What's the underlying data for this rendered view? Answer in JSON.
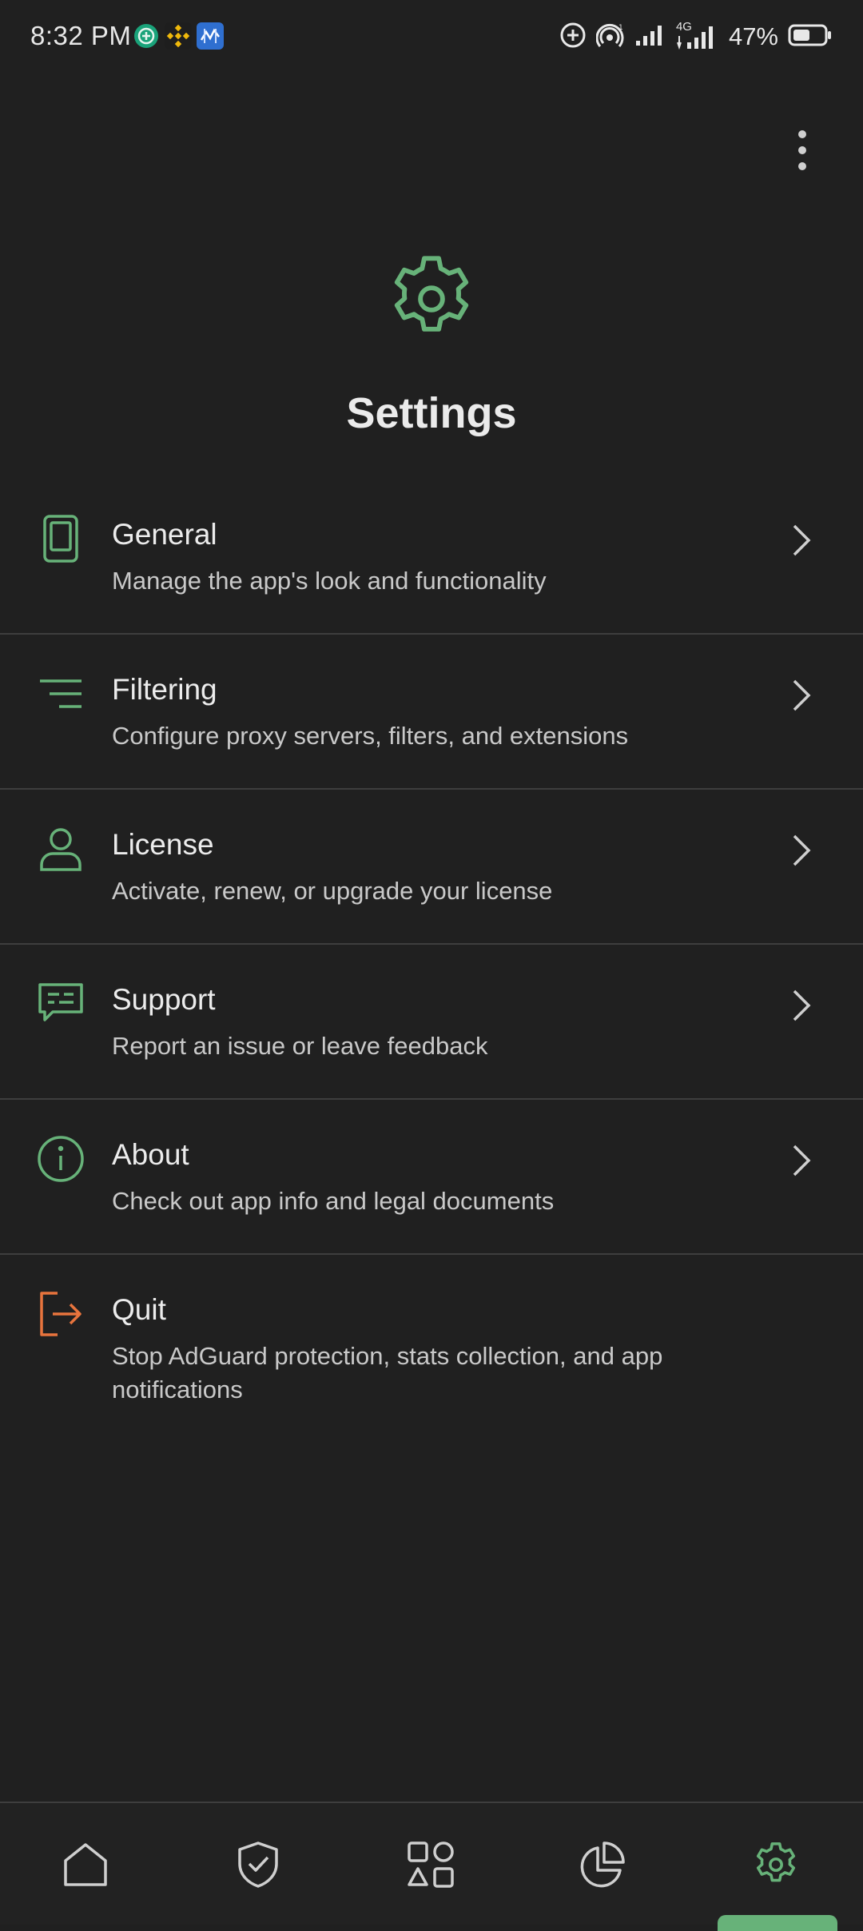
{
  "status_bar": {
    "time": "8:32 PM",
    "battery": "47%",
    "network": "4G",
    "notification_icons": [
      "chat-app-icon",
      "binance-icon",
      "data-transfer-icon"
    ]
  },
  "header": {
    "title": "Settings",
    "icon": "gear-icon",
    "menu_icon": "more-vert-icon"
  },
  "settings": {
    "items": [
      {
        "title": "General",
        "description": "Manage the app's look and functionality",
        "icon": "phone-icon"
      },
      {
        "title": "Filtering",
        "description": "Configure proxy servers, filters, and extensions",
        "icon": "filter-lines-icon"
      },
      {
        "title": "License",
        "description": "Activate, renew, or upgrade your license",
        "icon": "person-icon"
      },
      {
        "title": "Support",
        "description": "Report an issue or leave feedback",
        "icon": "chat-bubble-icon"
      },
      {
        "title": "About",
        "description": "Check out app info and legal documents",
        "icon": "info-icon"
      },
      {
        "title": "Quit",
        "description": "Stop AdGuard protection, stats collection, and app notifications",
        "icon": "exit-icon"
      }
    ]
  },
  "bottom_nav": {
    "items": [
      "home-icon",
      "shield-icon",
      "apps-icon",
      "statistics-icon",
      "settings-icon"
    ],
    "active": "settings-icon"
  },
  "colors": {
    "background": "#202020",
    "accent_green": "#67b279",
    "quit_orange": "#e8743d",
    "text_primary": "#ececec",
    "text_secondary": "#c9c9c9",
    "divider": "#3e3e3e"
  }
}
